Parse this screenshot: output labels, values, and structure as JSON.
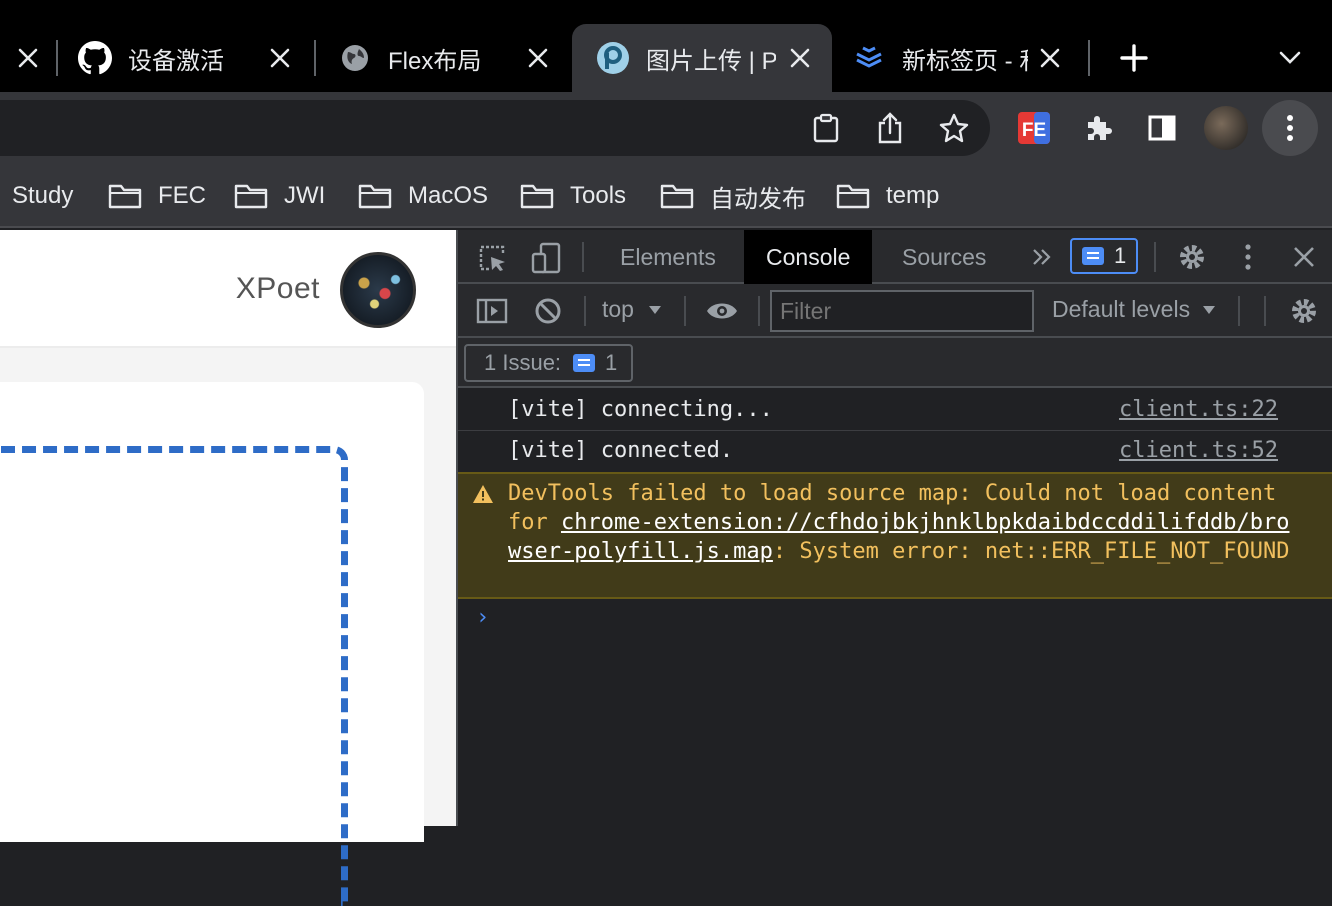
{
  "tabs": [
    {
      "title": "",
      "favicon": "none",
      "active": false
    },
    {
      "title": "设备激活",
      "favicon": "github-icon",
      "active": false
    },
    {
      "title": "Flex布局",
      "favicon": "globe-icon",
      "active": false
    },
    {
      "title": "图片上传 | P",
      "favicon": "picx-icon",
      "active": true
    },
    {
      "title": "新标签页 - 和",
      "favicon": "layers-icon",
      "active": false
    }
  ],
  "toolbar": {
    "icons": [
      "clipboard-icon",
      "share-icon",
      "star-icon",
      "fe-helper-icon",
      "extensions-icon",
      "side-panel-icon",
      "profile-avatar",
      "menu-icon"
    ]
  },
  "bookmarks": [
    {
      "label": "Study",
      "folder": false
    },
    {
      "label": "FEC",
      "folder": true
    },
    {
      "label": "JWI",
      "folder": true
    },
    {
      "label": "MacOS",
      "folder": true
    },
    {
      "label": "Tools",
      "folder": true
    },
    {
      "label": "自动发布",
      "folder": true
    },
    {
      "label": "temp",
      "folder": true
    }
  ],
  "page": {
    "username": "XPoet"
  },
  "devtools": {
    "tabs": [
      "Elements",
      "Console",
      "Sources"
    ],
    "active_tab": "Console",
    "issue_count": "1",
    "context": "top",
    "filter_placeholder": "Filter",
    "levels": "Default levels",
    "issues_label": "1 Issue:",
    "issues_count": "1",
    "logs": [
      {
        "message": "[vite] connecting...",
        "source": "client.ts:22"
      },
      {
        "message": "[vite] connected.",
        "source": "client.ts:52"
      }
    ],
    "warning": {
      "prefix": "DevTools failed to load source map: Could not load content for ",
      "link": "chrome-extension://cfhdojbkjhnklbpkdaibdccddilifddb/browser-polyfill.js.map",
      "suffix": ": System error: net::ERR_FILE_NOT_FOUND"
    },
    "prompt": "›"
  },
  "colors": {
    "accent": "#4d8df6",
    "warning_text": "#f2c05e",
    "warning_bg": "#413b19",
    "dashed_border": "#2e6cc7"
  }
}
